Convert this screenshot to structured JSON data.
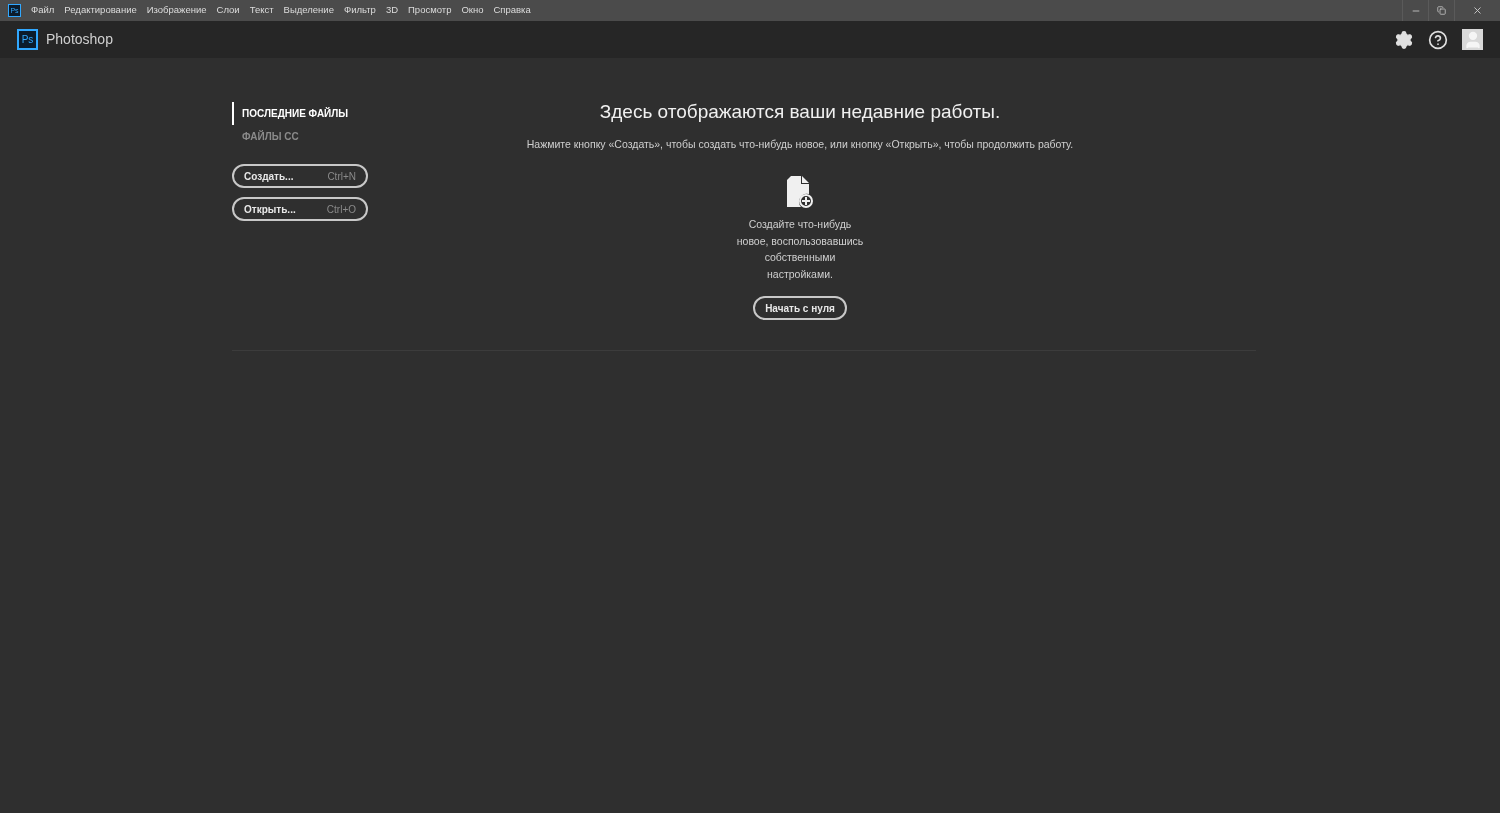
{
  "menu_bar": {
    "logo": "Ps",
    "items": [
      "Файл",
      "Редактирование",
      "Изображение",
      "Слои",
      "Текст",
      "Выделение",
      "Фильтр",
      "3D",
      "Просмотр",
      "Окно",
      "Справка"
    ]
  },
  "header": {
    "logo": "Ps",
    "title": "Photoshop"
  },
  "sidebar": {
    "tabs": [
      {
        "label": "ПОСЛЕДНИЕ ФАЙЛЫ",
        "selected": true
      },
      {
        "label": "ФАЙЛЫ CC",
        "selected": false
      }
    ],
    "buttons": [
      {
        "label": "Создать...",
        "shortcut": "Ctrl+N"
      },
      {
        "label": "Открыть...",
        "shortcut": "Ctrl+O"
      }
    ]
  },
  "main": {
    "heading": "Здесь отображаются ваши недавние работы.",
    "subtitle": "Нажмите кнопку «Создать», чтобы создать что-нибудь новое, или кнопку «Открыть», чтобы продолжить работу.",
    "description": "Создайте что-нибудь новое, воспользовавшись собственными настройками.",
    "button": "Начать с нуля"
  }
}
